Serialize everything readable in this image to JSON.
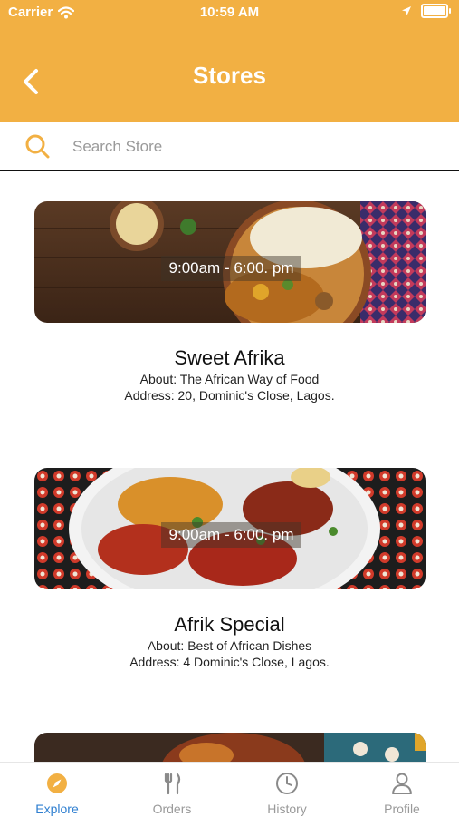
{
  "status_bar": {
    "carrier": "Carrier",
    "time": "10:59 AM"
  },
  "header": {
    "title": "Stores"
  },
  "search": {
    "placeholder": "Search Store"
  },
  "stores": [
    {
      "name": "Sweet Afrika",
      "hours": "9:00am - 6:00. pm",
      "about": "About: The African Way of Food",
      "address": "Address: 20, Dominic's Close, Lagos."
    },
    {
      "name": "Afrik Special",
      "hours": "9:00am - 6:00. pm",
      "about": "About: Best of African Dishes",
      "address": "Address: 4 Dominic's Close, Lagos."
    }
  ],
  "tabs": [
    {
      "label": "Explore",
      "icon": "compass-icon",
      "active": true
    },
    {
      "label": "Orders",
      "icon": "utensils-icon",
      "active": false
    },
    {
      "label": "History",
      "icon": "clock-icon",
      "active": false
    },
    {
      "label": "Profile",
      "icon": "person-icon",
      "active": false
    }
  ],
  "colors": {
    "header": "#F2B043",
    "accent": "#2f7fd0",
    "search_icon": "#F2B043"
  }
}
